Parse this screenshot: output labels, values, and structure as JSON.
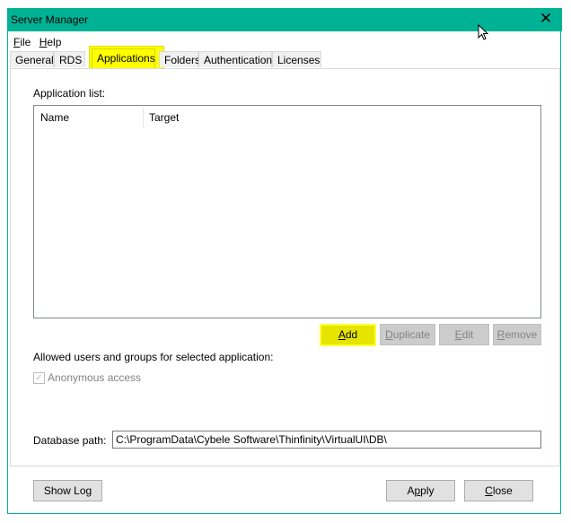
{
  "window": {
    "title": "Server Manager",
    "title_bar_color": "#00b294",
    "close_icon": "close-icon"
  },
  "menu": [
    {
      "label": "File",
      "accel": "F",
      "rest": "ile"
    },
    {
      "label": "Help",
      "accel": "H",
      "rest": "elp"
    }
  ],
  "tabs": [
    {
      "label": "General",
      "active": false
    },
    {
      "label": "RDS",
      "active": false
    },
    {
      "label": "Applications",
      "active": true
    },
    {
      "label": "Folders",
      "active": false
    },
    {
      "label": "Authentication",
      "active": false
    },
    {
      "label": "Licenses",
      "active": false
    }
  ],
  "applications": {
    "list_label": "Application list:",
    "columns": [
      "Name",
      "Target"
    ],
    "rows": [],
    "buttons": {
      "add": {
        "accel": "A",
        "rest": "dd",
        "enabled": true
      },
      "duplicate": {
        "accel": "D",
        "rest": "uplicate",
        "enabled": false
      },
      "edit": {
        "accel": "E",
        "rest": "dit",
        "enabled": false
      },
      "remove": {
        "accel": "R",
        "rest": "emove",
        "enabled": false
      }
    },
    "allowed_label": "Allowed users and groups for selected application:",
    "anonymous_access": {
      "label": "Anonymous access",
      "checked": true,
      "enabled": false
    },
    "database_path_label": "Database path:",
    "database_path_value": "C:\\ProgramData\\Cybele Software\\Thinfinity\\VirtualUI\\DB\\"
  },
  "footer": {
    "show_log": "Show Log",
    "apply": {
      "pre": "A",
      "accel": "p",
      "rest": "ply"
    },
    "close": {
      "accel": "C",
      "rest": "lose"
    }
  },
  "highlight_color": "#ffff00"
}
